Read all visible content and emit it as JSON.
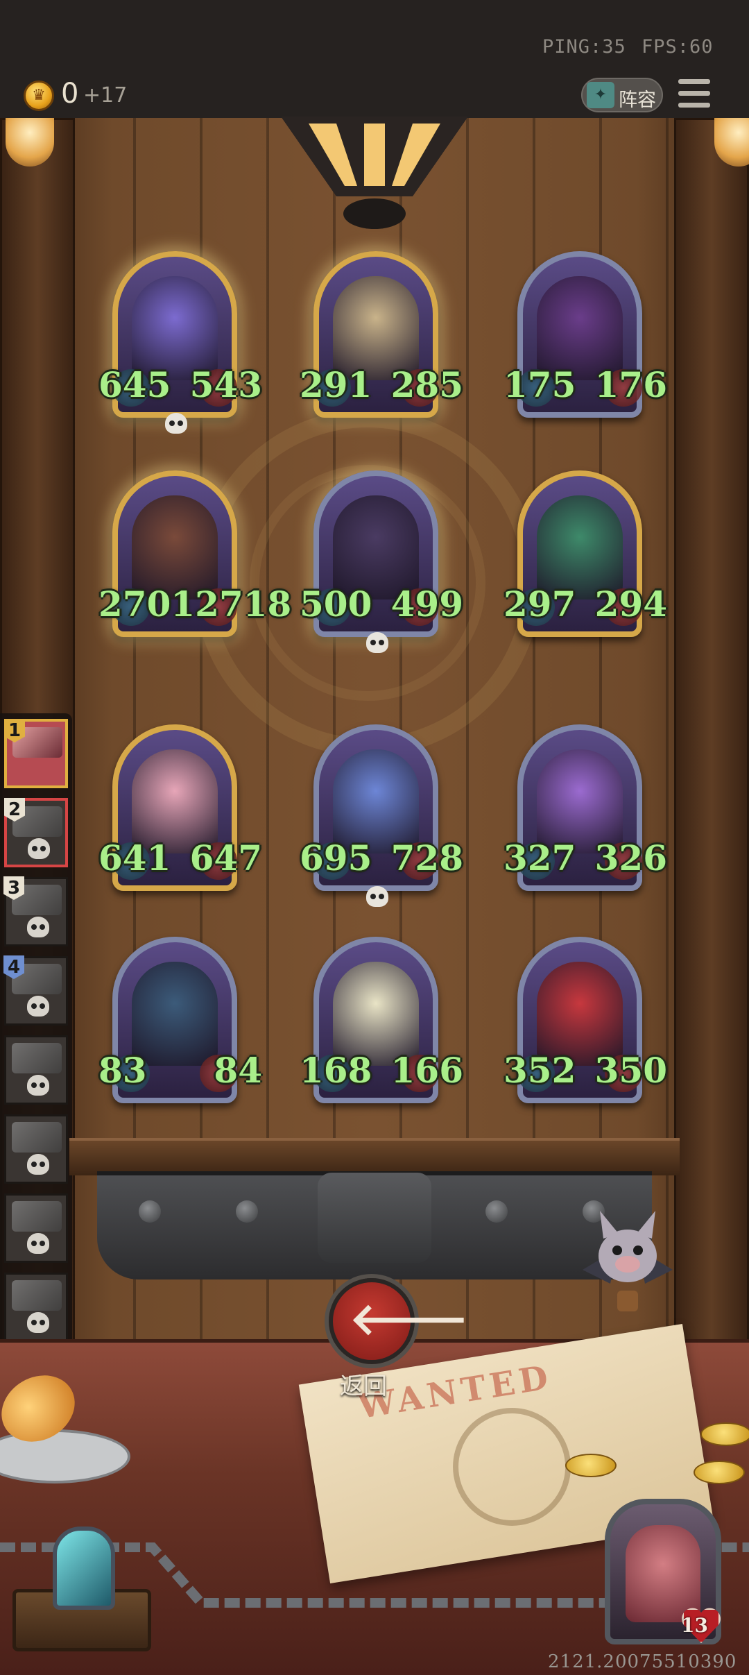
{
  "status": {
    "ping": "PING:35",
    "fps": "FPS:60"
  },
  "currency": {
    "amount": "0",
    "bonus": "+17",
    "icon": "crown-coin-icon",
    "color": "#e8a21c"
  },
  "header": {
    "lineup_label": "阵容",
    "menu_icon": "hamburger-menu-icon"
  },
  "board": {
    "rows": [
      [
        {
          "attack": "645",
          "health": "543",
          "frame": "gold",
          "skull": true,
          "art": "pelican-creature"
        },
        {
          "attack": "291",
          "health": "285",
          "frame": "gold",
          "skull": false,
          "art": "cow-dog"
        },
        {
          "attack": "175",
          "health": "176",
          "frame": "silver",
          "skull": false,
          "art": "butterfly"
        }
      ],
      [
        {
          "attack": "2701",
          "health": "2718",
          "frame": "gold",
          "skull": false,
          "art": "boar"
        },
        {
          "attack": "500",
          "health": "499",
          "frame": "silver",
          "skull": true,
          "art": "horned-elf"
        },
        {
          "attack": "297",
          "health": "294",
          "frame": "gold",
          "skull": false,
          "art": "snake"
        }
      ],
      [
        {
          "attack": "641",
          "health": "647",
          "frame": "gold",
          "skull": false,
          "art": "flower-fairy"
        },
        {
          "attack": "695",
          "health": "728",
          "frame": "silver",
          "skull": true,
          "art": "blue-haired-maiden"
        },
        {
          "attack": "327",
          "health": "326",
          "frame": "silver",
          "skull": false,
          "art": "green-witch"
        }
      ],
      [
        {
          "attack": "83",
          "health": "84",
          "frame": "silver",
          "skull": false,
          "art": "dark-elf"
        },
        {
          "attack": "168",
          "health": "166",
          "frame": "silver",
          "skull": false,
          "art": "singing-daisies"
        },
        {
          "attack": "352",
          "health": "350",
          "frame": "silver",
          "skull": false,
          "art": "clown-puppet"
        }
      ]
    ]
  },
  "opponents": [
    {
      "rank": "1",
      "state": "active"
    },
    {
      "rank": "2",
      "state": "selected"
    },
    {
      "rank": "3",
      "state": "dead"
    },
    {
      "rank": "4",
      "state": "dead"
    },
    {
      "rank": "",
      "state": "dead"
    },
    {
      "rank": "",
      "state": "dead"
    },
    {
      "rank": "",
      "state": "dead"
    },
    {
      "rank": "",
      "state": "dead"
    }
  ],
  "back_button": {
    "label": "返回",
    "icon": "back-arrow-icon"
  },
  "poster": {
    "title": "WANTED"
  },
  "player": {
    "health": "13"
  },
  "build_id": "2121.20075510390"
}
